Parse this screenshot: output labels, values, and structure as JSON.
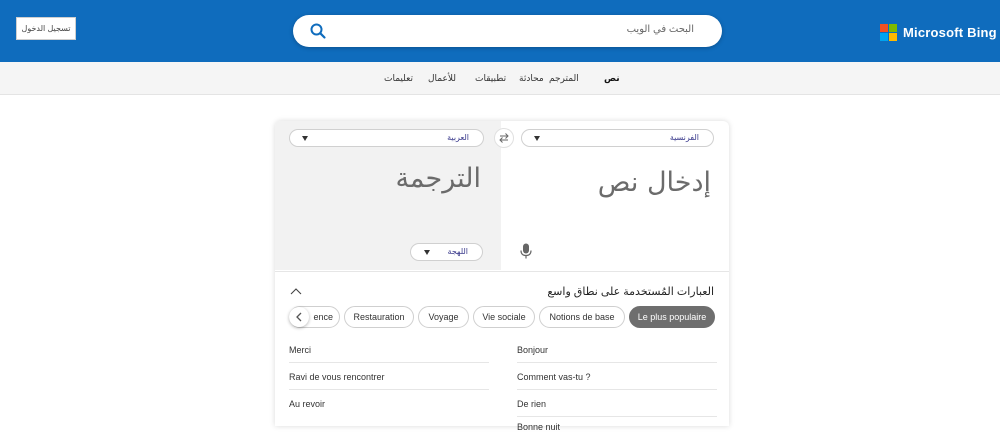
{
  "header": {
    "login_label": "تسجيل الدخول",
    "search_placeholder": "البحث في الويب",
    "brand": "Microsoft Bing",
    "bar_color": "#0f6cbd"
  },
  "nav": {
    "items": [
      "نص",
      "المترجم",
      "محادثة",
      "تطبيقات",
      "للأعمال",
      "تعليمات"
    ]
  },
  "translator": {
    "target_language": "العربية",
    "source_language": "الفرنسية",
    "output_placeholder": "الترجمة",
    "input_placeholder": "إدخال نص",
    "dialect_label": "اللهجة"
  },
  "phrases": {
    "title": "العبارات المُستخدمة على نطاق واسع",
    "categories": [
      "ence",
      "Restauration",
      "Voyage",
      "Vie sociale",
      "Notions de base",
      "Le plus populaire"
    ],
    "selected_category": "Le plus populaire",
    "left_column": [
      "Merci",
      "Ravi de vous rencontrer",
      "Au revoir"
    ],
    "right_column": [
      "Bonjour",
      "Comment vas-tu ?",
      "De rien",
      "Bonne nuit"
    ]
  },
  "icons": {
    "search": "search-icon",
    "swap": "swap-icon",
    "mic": "microphone-icon",
    "collapse": "chevron-up-icon",
    "prev": "chevron-left-icon"
  }
}
